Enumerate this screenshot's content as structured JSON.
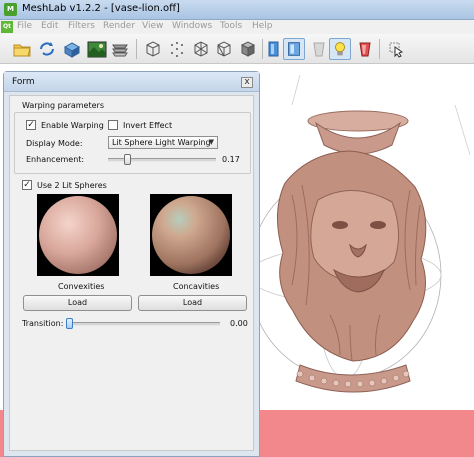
{
  "window": {
    "title": "MeshLab v1.2.2 - [vase-lion.off]",
    "app_icon_glyph": "M"
  },
  "menubar": {
    "logo_text": "Qt",
    "items": [
      "File",
      "Edit",
      "Filters",
      "Render",
      "View",
      "Windows",
      "Tools",
      "Help"
    ]
  },
  "toolbar": {
    "icons": [
      "open-folder-icon",
      "reload-icon",
      "export-icon",
      "snapshot-icon",
      "layers-icon",
      "bounding-box-icon",
      "points-icon",
      "wireframe-icon",
      "hidden-lines-icon",
      "flat-shading-icon",
      "smooth-shading-icon",
      "texture-icon",
      "lighting-bulb-icon",
      "double-side-icon",
      "select-faces-icon"
    ]
  },
  "form": {
    "title": "Form",
    "close_glyph": "x",
    "warping_group": "Warping parameters",
    "enable_warping": {
      "label": "Enable Warping",
      "checked": true
    },
    "invert_effect": {
      "label": "Invert Effect",
      "checked": false
    },
    "display_mode_label": "Display Mode:",
    "display_mode_value": "Lit Sphere Light Warping",
    "enhancement_label": "Enhancement:",
    "enhancement_value": "0.17",
    "use_two_spheres": {
      "label": "Use 2 Lit Spheres",
      "checked": true
    },
    "convexities_label": "Convexities",
    "concavities_label": "Concavities",
    "load_label": "Load",
    "transition_label": "Transition:",
    "transition_value": "0.00",
    "check_glyph": "✓"
  },
  "colors": {
    "background": "#ffffff",
    "floor": "#f2888c",
    "model": "#c99a8c",
    "dialog_frame": "#dde6ef"
  }
}
